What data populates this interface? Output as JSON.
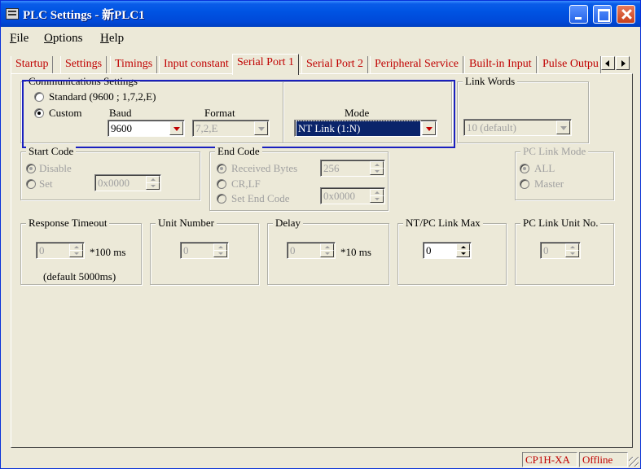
{
  "window": {
    "title": "PLC Settings - 新PLC1"
  },
  "menu": [
    {
      "label": "File"
    },
    {
      "label": "Options"
    },
    {
      "label": "Help"
    }
  ],
  "tabs": [
    {
      "label": "Startup",
      "active": false
    },
    {
      "label": "Settings",
      "active": false
    },
    {
      "label": "Timings",
      "active": false
    },
    {
      "label": "Input constant",
      "active": false
    },
    {
      "label": "Serial Port 1",
      "active": true
    },
    {
      "label": "Serial Port 2",
      "active": false
    },
    {
      "label": "Peripheral Service",
      "active": false
    },
    {
      "label": "Built-in Input",
      "active": false
    },
    {
      "label": "Pulse Outpu",
      "active": false
    }
  ],
  "comm": {
    "legend": "Communications Settings",
    "standard_label": "Standard (9600 ; 1,7,2,E)",
    "custom_label": "Custom",
    "selected": "custom",
    "baud_label": "Baud",
    "baud_value": "9600",
    "format_label": "Format",
    "format_value": "7,2,E",
    "mode_label": "Mode",
    "mode_value": "NT Link (1:N)"
  },
  "link_words": {
    "legend": "Link Words",
    "value": "10 (default)"
  },
  "start_code": {
    "legend": "Start Code",
    "disable_label": "Disable",
    "set_label": "Set",
    "value": "0x0000"
  },
  "end_code": {
    "legend": "End Code",
    "received_label": "Received Bytes",
    "received_value": "256",
    "crlf_label": "CR,LF",
    "set_end_label": "Set End Code",
    "set_end_value": "0x0000"
  },
  "pc_link_mode": {
    "legend": "PC Link Mode",
    "all_label": "ALL",
    "master_label": "Master"
  },
  "response_timeout": {
    "legend": "Response Timeout",
    "value": "0",
    "unit": "*100 ms",
    "note": "(default 5000ms)"
  },
  "unit_number": {
    "legend": "Unit Number",
    "value": "0"
  },
  "delay": {
    "legend": "Delay",
    "value": "0",
    "unit": "*10 ms"
  },
  "nt_pc_link_max": {
    "legend": "NT/PC Link Max",
    "value": "0"
  },
  "pc_link_unit_no": {
    "legend": "PC Link Unit No.",
    "value": "0"
  },
  "status": {
    "model": "CP1H-XA",
    "state": "Offline"
  }
}
